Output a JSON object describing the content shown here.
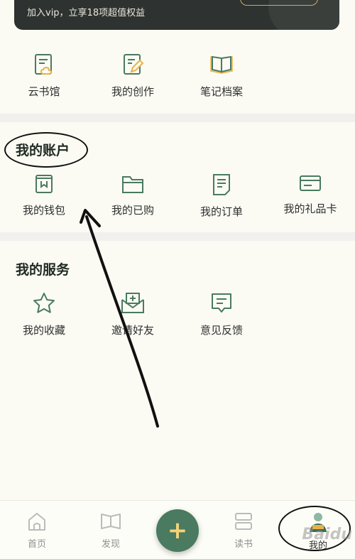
{
  "vip_banner": {
    "text": "加入vip，立享18项超值权益"
  },
  "top_section": {
    "items": [
      {
        "label": "云书馆",
        "icon": "cloud-book-icon"
      },
      {
        "label": "我的创作",
        "icon": "edit-note-icon"
      },
      {
        "label": "笔记档案",
        "icon": "open-book-icon"
      }
    ]
  },
  "account_section": {
    "title": "我的账户",
    "items": [
      {
        "label": "我的钱包",
        "icon": "wallet-icon"
      },
      {
        "label": "我的已购",
        "icon": "folder-icon"
      },
      {
        "label": "我的订单",
        "icon": "order-icon"
      },
      {
        "label": "我的礼品卡",
        "icon": "gift-card-icon"
      }
    ]
  },
  "service_section": {
    "title": "我的服务",
    "items": [
      {
        "label": "我的收藏",
        "icon": "star-icon"
      },
      {
        "label": "邀请好友",
        "icon": "invite-mail-icon"
      },
      {
        "label": "意见反馈",
        "icon": "feedback-icon"
      }
    ]
  },
  "tabbar": {
    "items": [
      {
        "label": "首页",
        "icon": "home-icon"
      },
      {
        "label": "发现",
        "icon": "discover-book-icon"
      },
      {
        "label": "",
        "icon": "plus-icon",
        "glyph": "+"
      },
      {
        "label": "读书",
        "icon": "bookshelf-icon"
      },
      {
        "label": "我的",
        "icon": "avatar-icon"
      }
    ]
  },
  "colors": {
    "accent_green": "#4a7a5f",
    "icon_orange": "#e8b24a",
    "background": "#fbfbf4"
  },
  "watermark": "Baidu"
}
